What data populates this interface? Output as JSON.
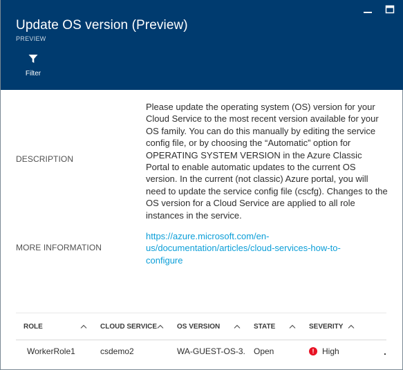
{
  "header": {
    "title": "Update OS version (Preview)",
    "subtitle": "PREVIEW"
  },
  "toolbar": {
    "filter_label": "Filter"
  },
  "details": {
    "description_label": "DESCRIPTION",
    "description_text": "Please update the operating system (OS) version for your Cloud Service to the most recent version available for your OS family. You can do this manually by editing the service config file, or by choosing the “Automatic” option for OPERATING SYSTEM VERSION in the Azure Classic Portal to enable automatic updates to the current OS version. In the current (not classic) Azure portal, you will need to update the service config file (cscfg). Changes to the OS version for a Cloud Service are applied to all role instances in the service.",
    "more_info_label": "MORE INFORMATION",
    "more_info_link": "https://azure.microsoft.com/en-us/documentation/articles/cloud-services-how-to-configure"
  },
  "grid": {
    "columns": [
      "ROLE",
      "CLOUD SERVICE",
      "OS VERSION",
      "STATE",
      "SEVERITY"
    ],
    "rows": [
      {
        "role": "WorkerRole1",
        "cloud_service": "csdemo2",
        "os_version": "WA-GUEST-OS-3...",
        "state": "Open",
        "severity": "High",
        "more": "..."
      }
    ]
  },
  "icons": {
    "filter": "filter-icon",
    "minimize": "minimize-icon",
    "maximize": "maximize-icon",
    "sort": "chevron-up-icon",
    "severity": "error-icon",
    "more": "ellipsis-icon"
  },
  "colors": {
    "header_bg": "#003b6f",
    "link": "#0b9ed8",
    "severity_high": "#e81123"
  }
}
